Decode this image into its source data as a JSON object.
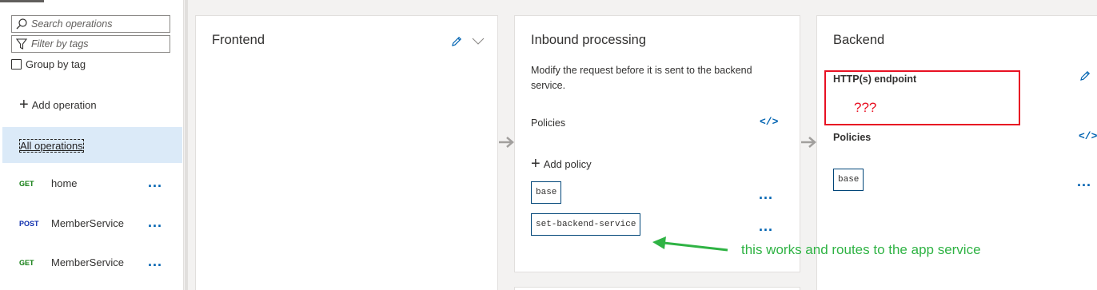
{
  "sidebar": {
    "search_placeholder": "Search operations",
    "filter_placeholder": "Filter by tags",
    "group_by_label": "Group by tag",
    "add_operation_label": "Add operation",
    "all_operations_label": "All operations",
    "operations": [
      {
        "verb": "GET",
        "name": "home"
      },
      {
        "verb": "POST",
        "name": "MemberService"
      },
      {
        "verb": "GET",
        "name": "MemberService"
      }
    ],
    "more_glyph": "..."
  },
  "frontend": {
    "title": "Frontend"
  },
  "inbound": {
    "title": "Inbound processing",
    "description": "Modify the request before it is sent to the backend service.",
    "policies_label": "Policies",
    "code_glyph": "</>",
    "add_policy_label": "Add policy",
    "policies": [
      "base",
      "set-backend-service"
    ]
  },
  "backend": {
    "title": "Backend",
    "endpoint_label": "HTTP(s) endpoint",
    "endpoint_value": "???",
    "policies_label": "Policies",
    "code_glyph": "</>",
    "policies": [
      "base"
    ]
  },
  "annotation": {
    "text": "this works and routes to the app service",
    "color": "#2fb344"
  },
  "colors": {
    "accent": "#0063b1",
    "highlight_box": "#e81123",
    "get_verb": "#107c10",
    "post_verb": "#0f2fae",
    "selected_row": "#dbeaf8"
  }
}
